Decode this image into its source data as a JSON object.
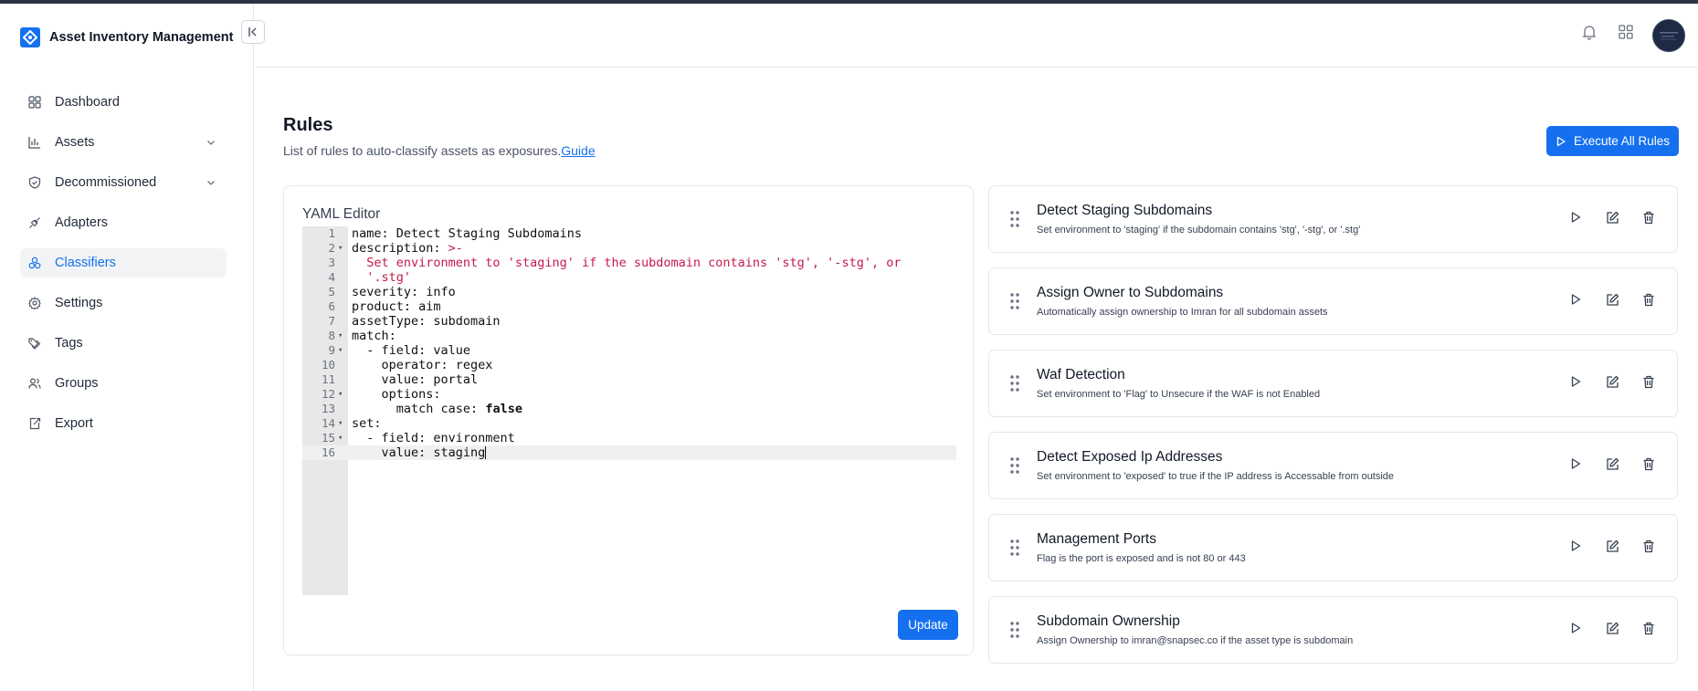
{
  "app": {
    "title": "Asset Inventory Management"
  },
  "sidebar": {
    "items": [
      {
        "label": "Dashboard",
        "icon": "grid-icon",
        "active": false,
        "expandable": false
      },
      {
        "label": "Assets",
        "icon": "chart-icon",
        "active": false,
        "expandable": true
      },
      {
        "label": "Decommissioned",
        "icon": "shield-icon",
        "active": false,
        "expandable": true
      },
      {
        "label": "Adapters",
        "icon": "plug-icon",
        "active": false,
        "expandable": false
      },
      {
        "label": "Classifiers",
        "icon": "shapes-icon",
        "active": true,
        "expandable": false
      },
      {
        "label": "Settings",
        "icon": "gear-icon",
        "active": false,
        "expandable": false
      },
      {
        "label": "Tags",
        "icon": "tags-icon",
        "active": false,
        "expandable": false
      },
      {
        "label": "Groups",
        "icon": "users-icon",
        "active": false,
        "expandable": false
      },
      {
        "label": "Export",
        "icon": "export-icon",
        "active": false,
        "expandable": false
      }
    ]
  },
  "page": {
    "title": "Rules",
    "subtitle": "List of rules to auto-classify assets as exposures.",
    "guide_link": "Guide",
    "execute_all_label": "Execute All Rules"
  },
  "editor": {
    "label": "YAML Editor",
    "update_label": "Update",
    "lines": [
      {
        "n": "1",
        "fold": false,
        "text": "name: Detect Staging Subdomains"
      },
      {
        "n": "2",
        "fold": true,
        "text": "description: ",
        "str": ">-"
      },
      {
        "n": "3",
        "fold": false,
        "text": "  ",
        "str": "Set environment to 'staging' if the subdomain contains 'stg', '-stg', or"
      },
      {
        "n": "4",
        "fold": false,
        "text": "  ",
        "str": "'.stg'"
      },
      {
        "n": "5",
        "fold": false,
        "text": "severity: info"
      },
      {
        "n": "6",
        "fold": false,
        "text": "product: aim"
      },
      {
        "n": "7",
        "fold": false,
        "text": "assetType: subdomain"
      },
      {
        "n": "8",
        "fold": true,
        "text": "match:"
      },
      {
        "n": "9",
        "fold": true,
        "text": "  - field: value"
      },
      {
        "n": "10",
        "fold": false,
        "text": "    operator: regex"
      },
      {
        "n": "11",
        "fold": false,
        "text": "    value: portal"
      },
      {
        "n": "12",
        "fold": true,
        "text": "    options:"
      },
      {
        "n": "13",
        "fold": false,
        "text": "      match case: ",
        "kw": "false"
      },
      {
        "n": "14",
        "fold": true,
        "text": "set:"
      },
      {
        "n": "15",
        "fold": true,
        "text": "  - field: environment"
      },
      {
        "n": "16",
        "fold": false,
        "text": "    value: staging",
        "current": true
      }
    ]
  },
  "rules": [
    {
      "title": "Detect Staging Subdomains",
      "description": "Set environment to 'staging' if the subdomain contains 'stg', '-stg', or '.stg'"
    },
    {
      "title": "Assign Owner to Subdomains",
      "description": "Automatically assign ownership to Imran for all subdomain assets"
    },
    {
      "title": "Waf Detection",
      "description": "Set environment to 'Flag' to Unsecure if the WAF is not Enabled"
    },
    {
      "title": "Detect Exposed Ip Addresses",
      "description": "Set environment to 'exposed' to true if the IP address is Accessable from outside"
    },
    {
      "title": "Management Ports",
      "description": "Flag is the port is exposed and is not 80 or 443"
    },
    {
      "title": "Subdomain Ownership",
      "description": "Assign Ownership to imran@snapsec.co if the asset type is subdomain"
    }
  ],
  "colors": {
    "accent": "#1570ef",
    "string": "#c41a4a",
    "active_bg": "#f1f3f5"
  }
}
